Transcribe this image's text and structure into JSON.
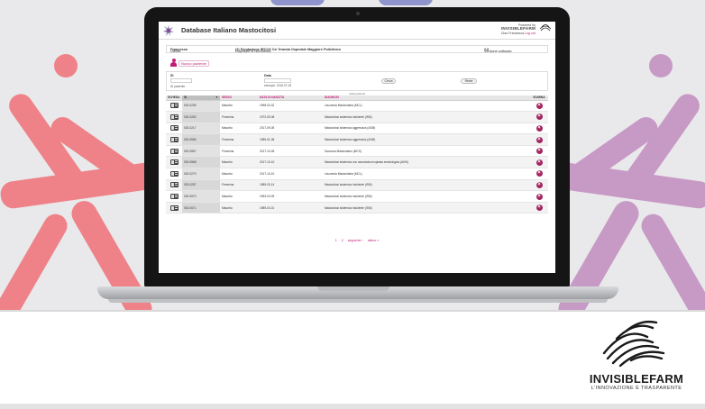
{
  "app": {
    "title": "Database Italiano Mastocitosi",
    "brand_powered": "Powered by",
    "brand_name": "INVISIBLEFARM",
    "user_label": "Ciao Francesca",
    "logout_label": "Log out"
  },
  "infobar": {
    "user_prefix": "Utente:",
    "user_value": "Francesca",
    "hospital_prefix": "Ospedale di riferimento:",
    "hospital_value": "(2) Fondazione IRCCS Ca' Granda Ospedale Maggiore Policlinico",
    "version_prefix": "Versione software:",
    "version_value": "2.0"
  },
  "new_patient_label": "Nuovo paziente",
  "filter": {
    "id_label": "ID",
    "id_hint": "ID paziente",
    "date_label": "Data",
    "date_hint": "esempio: 2018-07-06",
    "search_button": "Cerca",
    "reset_button": "Reset"
  },
  "results_count": "Vista pazienti",
  "table": {
    "headers": [
      "SCHEDA",
      "ID",
      "SESSO",
      "DATA DI NASCITA",
      "DIAGNOSI",
      "ELIMINA"
    ],
    "rows": [
      {
        "id": "002-0255",
        "sex": "Maschio",
        "dob": "1998-03-02",
        "dx": "Leucemia Mastocitaria (MCL)"
      },
      {
        "id": "002-0262",
        "sex": "Femmina",
        "dob": "1972-09-08",
        "dx": "Mastocitosi sistemica indolente (ISM)"
      },
      {
        "id": "002-0217",
        "sex": "Maschio",
        "dob": "2017-09-05",
        "dx": "Mastocitosi sistemica aggressiva (ASM)"
      },
      {
        "id": "002-0565",
        "sex": "Femmina",
        "dob": "1985-01-08",
        "dx": "Mastocitosi sistemica aggressiva (ASM)"
      },
      {
        "id": "002-0567",
        "sex": "Femmina",
        "dob": "2017-10-05",
        "dx": "Sarcoma Mastocitario (MCS)"
      },
      {
        "id": "002-0568",
        "sex": "Maschio",
        "dob": "2017-10-10",
        "dx": "Mastocitosi sistemica con associata neoplasia ematologica (AHN)"
      },
      {
        "id": "002-0270",
        "sex": "Maschio",
        "dob": "2017-10-10",
        "dx": "Leucemia Mastocitaria (MCL)"
      },
      {
        "id": "002-0257",
        "sex": "Femmina",
        "dob": "1989-03-14",
        "dx": "Mastocitosi sistemica indolente (ISM)"
      },
      {
        "id": "002-0570",
        "sex": "Maschio",
        "dob": "1993-03-09",
        "dx": "Mastocitosi sistemica indolente (ISM)"
      },
      {
        "id": "002-0571",
        "sex": "Maschio",
        "dob": "1989-03-01",
        "dx": "Mastocitosi sistemica indolente (ISM)"
      }
    ]
  },
  "pager": {
    "page1": "1",
    "page2": "2",
    "next": "seguente ›",
    "last": "ultimo »"
  },
  "banner": {
    "company": "INVISIBLEFARM",
    "tagline": "L'INNOVAZIONE È TRASPARENTE"
  },
  "colors": {
    "accent": "#c21e74",
    "delete": "#a3245f",
    "figure_red": "#ee8288",
    "figure_purple": "#c79ac6",
    "figure_blue": "#8f94cc"
  }
}
